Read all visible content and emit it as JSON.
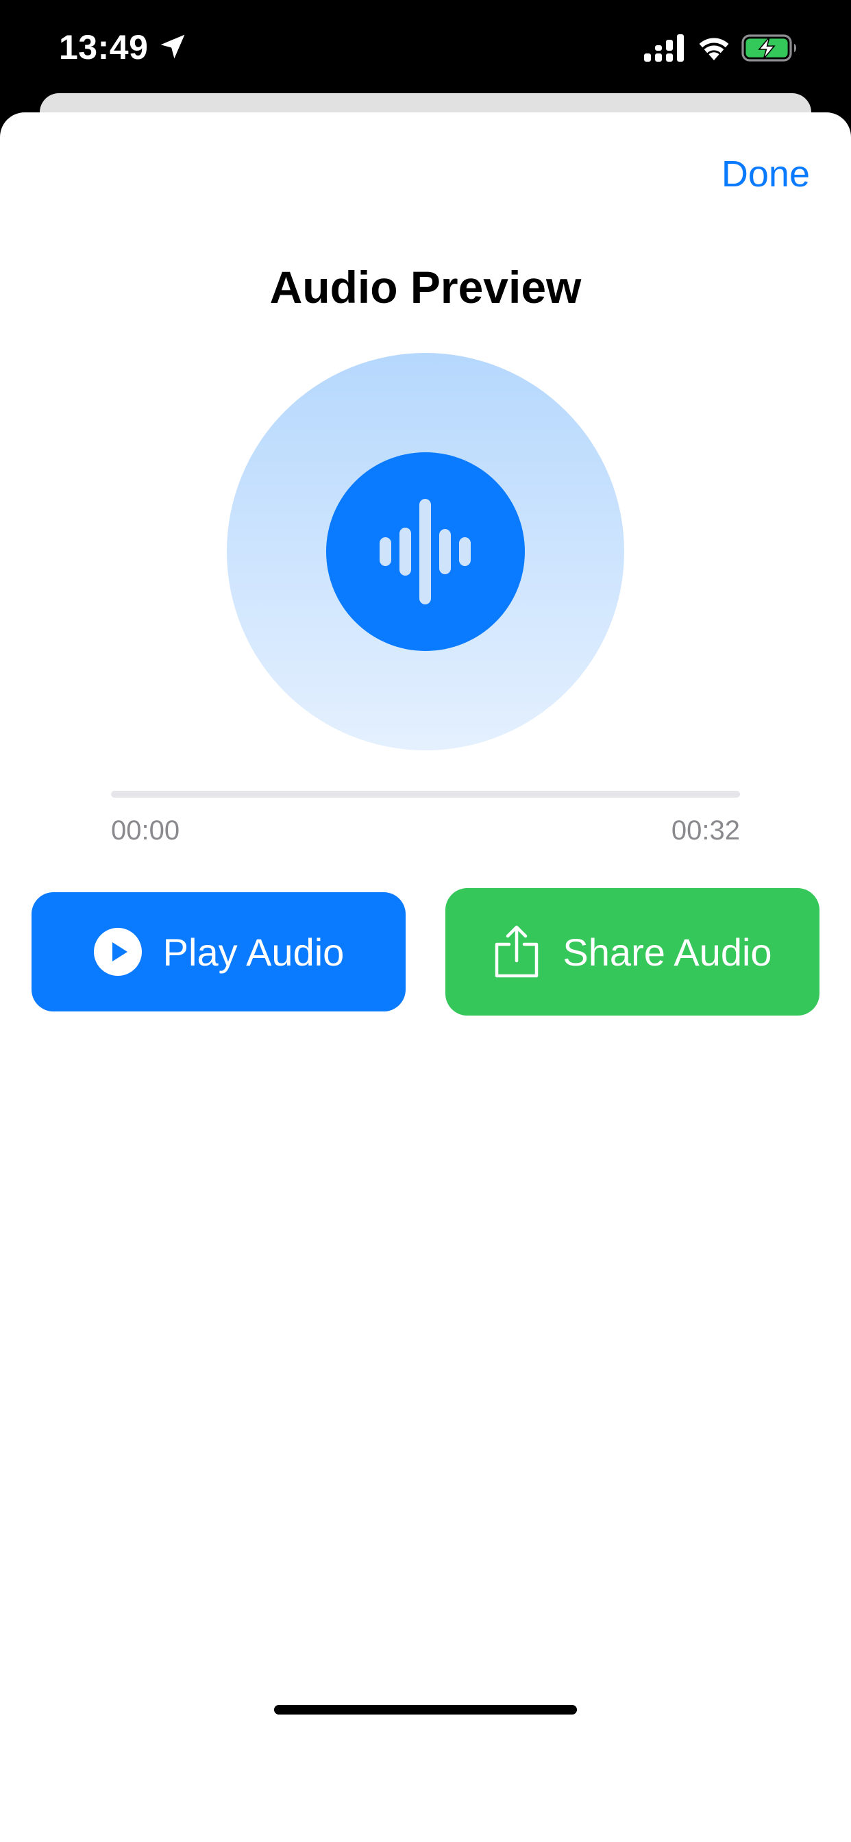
{
  "status_bar": {
    "time": "13:49"
  },
  "sheet": {
    "done_label": "Done",
    "title": "Audio Preview"
  },
  "player": {
    "elapsed": "00:00",
    "total": "00:32",
    "progress": 0
  },
  "actions": {
    "play_label": "Play Audio",
    "share_label": "Share Audio"
  },
  "icons": {
    "location": "location-arrow-icon",
    "signal": "cellular-signal-icon",
    "wifi": "wifi-icon",
    "battery": "battery-charging-icon",
    "waveform": "waveform-icon",
    "play": "play-circle-icon",
    "share": "share-icon"
  },
  "colors": {
    "accent_blue": "#0a7aff",
    "share_green": "#35c759",
    "battery_green": "#34c759",
    "artwork_top": "#b6d8fd",
    "artwork_bottom": "#e4f0fe",
    "secondary_text": "#8a8a8e"
  }
}
